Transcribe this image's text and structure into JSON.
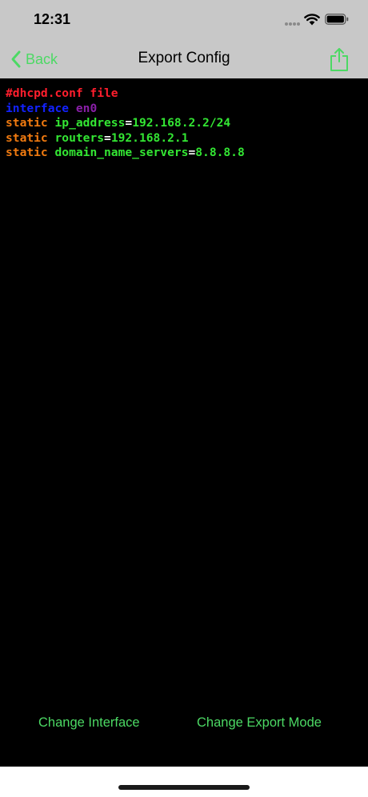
{
  "status_bar": {
    "time": "12:31",
    "icons": [
      "cellular-dots-icon",
      "wifi-icon",
      "battery-icon"
    ]
  },
  "nav": {
    "back_label": "Back",
    "title": "Export Config",
    "share_icon": "share-icon"
  },
  "code": {
    "lines": [
      [
        {
          "text": "#dhcpd.conf file",
          "kind": "comment"
        }
      ],
      [
        {
          "text": "interface",
          "kind": "keyword"
        },
        {
          "text": " ",
          "kind": "op"
        },
        {
          "text": "en0",
          "kind": "iface"
        }
      ],
      [
        {
          "text": "static",
          "kind": "static"
        },
        {
          "text": " ",
          "kind": "op"
        },
        {
          "text": "ip_address",
          "kind": "key"
        },
        {
          "text": "=",
          "kind": "op"
        },
        {
          "text": "192.168.2.2/24",
          "kind": "value"
        }
      ],
      [
        {
          "text": "static",
          "kind": "static"
        },
        {
          "text": " ",
          "kind": "op"
        },
        {
          "text": "routers",
          "kind": "key"
        },
        {
          "text": "=",
          "kind": "op"
        },
        {
          "text": "192.168.2.1",
          "kind": "value"
        }
      ],
      [
        {
          "text": "static",
          "kind": "static"
        },
        {
          "text": " ",
          "kind": "op"
        },
        {
          "text": "domain_name_servers",
          "kind": "key"
        },
        {
          "text": "=",
          "kind": "op"
        },
        {
          "text": "8.8.8.8",
          "kind": "value"
        }
      ]
    ]
  },
  "buttons": {
    "change_interface": "Change Interface",
    "change_export_mode": "Change Export Mode"
  },
  "colors": {
    "accent": "#4cd964",
    "bar_background": "#c8c8c8",
    "code_background": "#000000",
    "comment": "#ff1e2d",
    "keyword": "#1222ff",
    "iface": "#8a1fa8",
    "static": "#f07a10",
    "key": "#33e633",
    "value": "#33e633",
    "operator": "#ffffff"
  }
}
